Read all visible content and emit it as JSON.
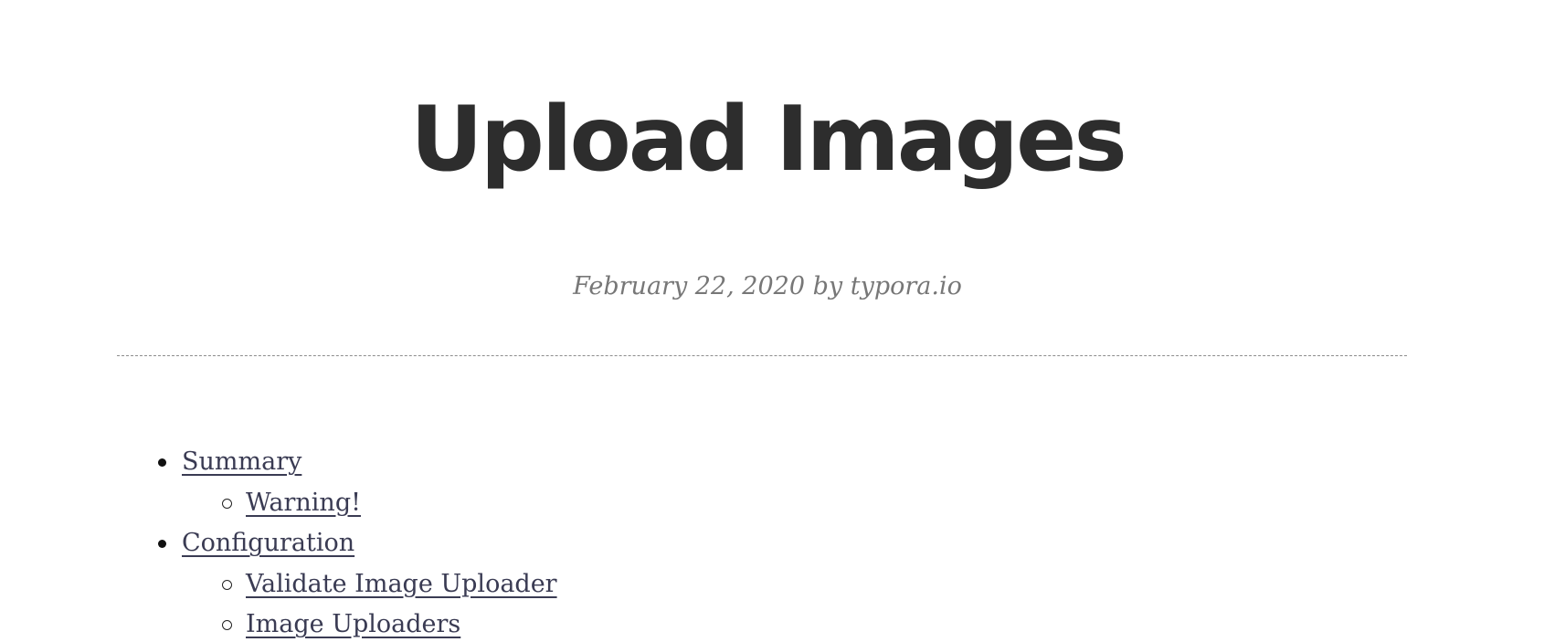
{
  "article": {
    "title": "Upload Images",
    "date": "February 22, 2020",
    "by_word": "by",
    "author": "typora.io"
  },
  "toc": {
    "items": [
      {
        "label": "Summary",
        "level": 1
      },
      {
        "label": "Warning!",
        "level": 2
      },
      {
        "label": "Configuration",
        "level": 1
      },
      {
        "label": "Validate Image Uploader",
        "level": 2
      },
      {
        "label": "Image Uploaders",
        "level": 2
      }
    ]
  }
}
